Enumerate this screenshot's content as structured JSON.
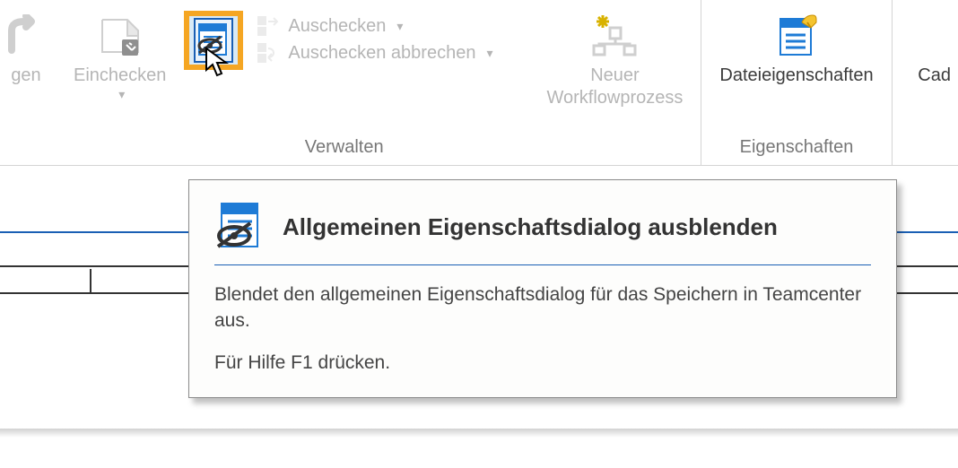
{
  "ribbon": {
    "group_manage_label": "Verwalten",
    "group_props_label": "Eigenschaften",
    "btn_truncated_left": "gen",
    "btn_checkin": "Einchecken",
    "btn_checkout": "Auschecken",
    "btn_cancel_checkout": "Auschecken abbrechen",
    "btn_new_workflow": "Neuer\nWorkflowprozess",
    "btn_file_properties": "Dateieigenschaften",
    "btn_truncated_right": "Cad"
  },
  "tooltip": {
    "title": "Allgemeinen Eigenschaftsdialog ausblenden",
    "body": "Blendet den allgemeinen Eigenschaftsdialog für das Speichern in Teamcenter aus.",
    "hint": "Für Hilfe F1 drücken."
  }
}
